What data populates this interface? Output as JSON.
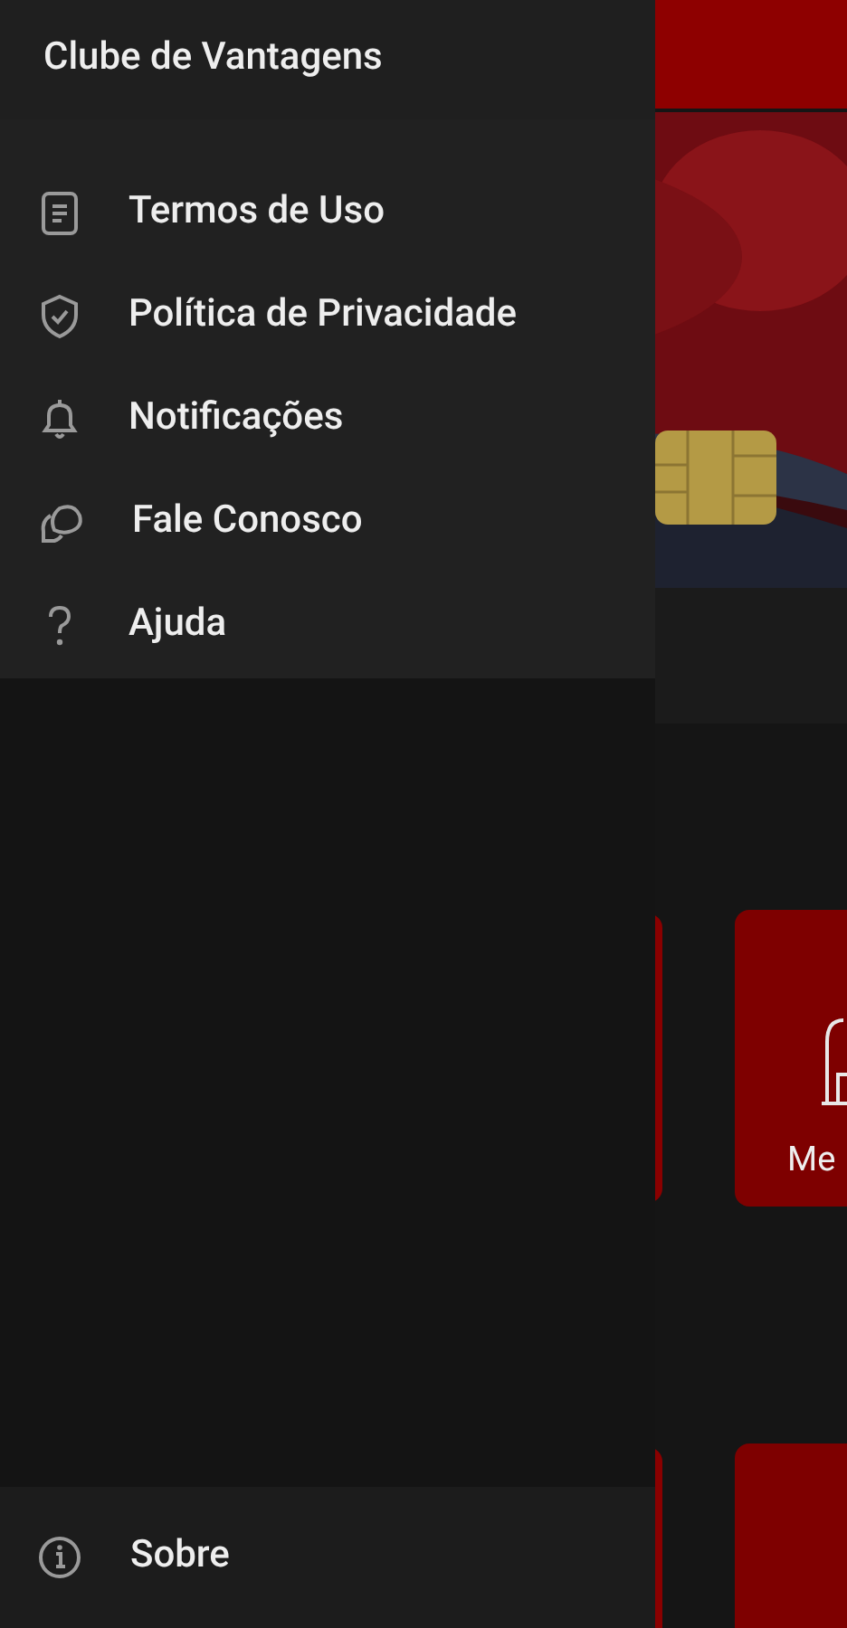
{
  "drawer": {
    "title": "Clube de Vantagens",
    "items": [
      {
        "label": "Termos de Uso"
      },
      {
        "label": "Política de Privacidade"
      },
      {
        "label": "Notificações"
      },
      {
        "label": "Fale Conosco"
      },
      {
        "label": "Ajuda"
      }
    ],
    "footer_item": {
      "label": "Sobre"
    }
  },
  "background": {
    "tiles": [
      {
        "label": "Me"
      }
    ]
  }
}
